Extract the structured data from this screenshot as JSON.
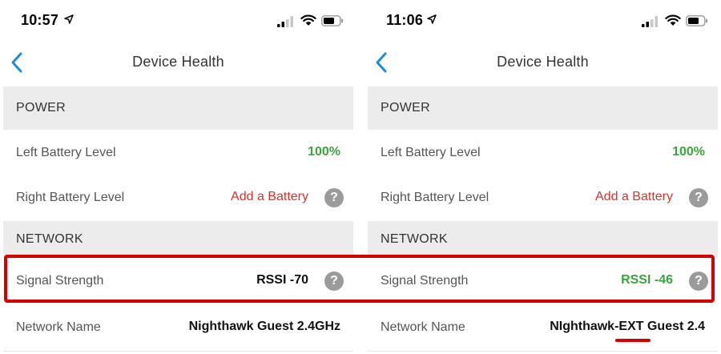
{
  "colors": {
    "accent_blue": "#1a8fd6",
    "value_green": "#3aa53a",
    "value_red": "#d9342b",
    "annotation_red": "#d60000",
    "section_bg": "#ececec"
  },
  "left_screen": {
    "status": {
      "time": "10:57"
    },
    "nav": {
      "title": "Device Health"
    },
    "sections": {
      "power": "POWER",
      "network": "NETWORK"
    },
    "rows": {
      "left_battery": {
        "label": "Left Battery Level",
        "value": "100%"
      },
      "right_battery": {
        "label": "Right Battery Level",
        "value": "Add a Battery"
      },
      "signal": {
        "label": "Signal Strength",
        "value": "RSSI -70"
      },
      "network_name": {
        "label": "Network Name",
        "value": "Nighthawk Guest 2.4GHz"
      }
    }
  },
  "right_screen": {
    "status": {
      "time": "11:06"
    },
    "nav": {
      "title": "Device Health"
    },
    "sections": {
      "power": "POWER",
      "network": "NETWORK"
    },
    "rows": {
      "left_battery": {
        "label": "Left Battery Level",
        "value": "100%"
      },
      "right_battery": {
        "label": "Right Battery Level",
        "value": "Add a Battery"
      },
      "signal": {
        "label": "Signal Strength",
        "value": "RSSI -46"
      },
      "network_name": {
        "label": "Network Name",
        "value": "NIghthawk-EXT Guest 2.4"
      }
    }
  },
  "icons": {
    "back": "chevron-left-icon",
    "help": "question-mark-icon",
    "help_glyph": "?",
    "location": "location-arrow-icon",
    "signal": "cellular-signal-icon",
    "wifi": "wifi-icon",
    "battery": "battery-icon"
  }
}
